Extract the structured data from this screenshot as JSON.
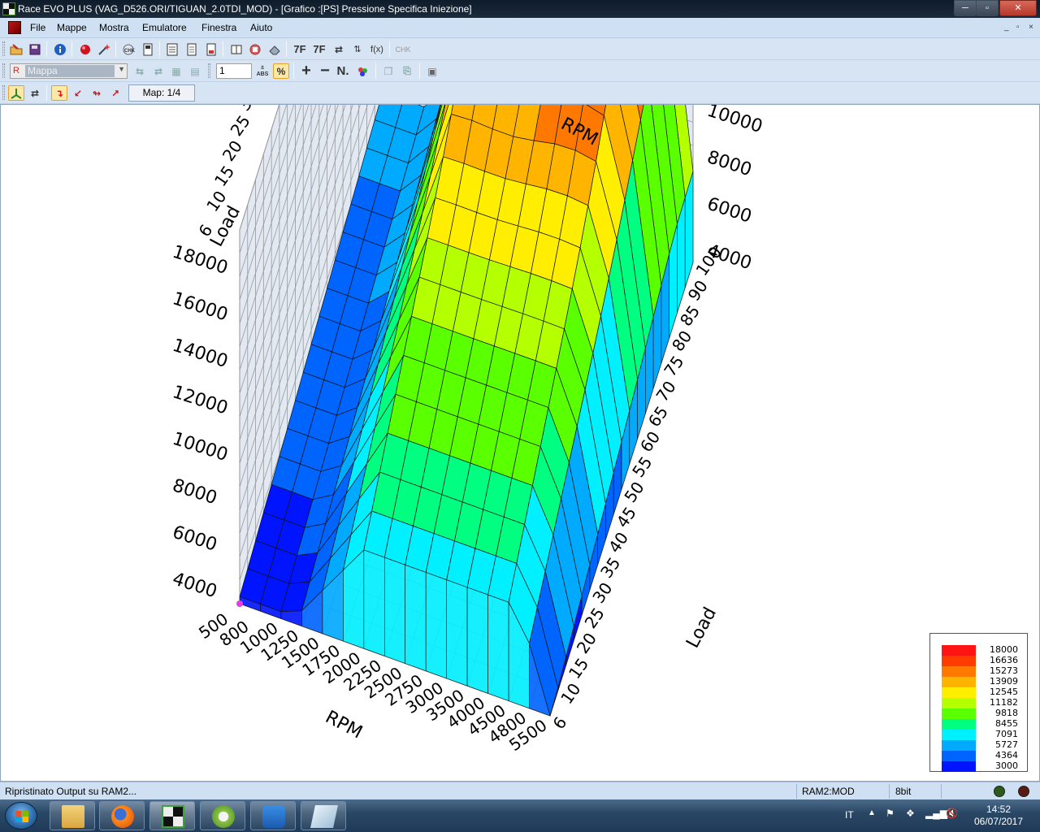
{
  "window": {
    "title": "Race EVO PLUS (VAG_D526.ORI/TIGUAN_2.0TDI_MOD) - [Grafico :[PS] Pressione Specifica Iniezione]",
    "minimize_glyph": "─",
    "maximize_glyph": "▫",
    "close_glyph": "✕"
  },
  "menu": {
    "items": [
      "File",
      "Mappe",
      "Mostra",
      "Emulatore",
      "Finestra",
      "Aiuto"
    ],
    "mdi_min": "_",
    "mdi_restore": "▫",
    "mdi_close": "×"
  },
  "toolbar1": {
    "icons": [
      "open-icon",
      "save-icon",
      "info-icon",
      "record-icon",
      "magic-icon",
      "checksum-icon",
      "page-icon",
      "calc-icon",
      "doc-icon",
      "pdf-icon",
      "book-icon",
      "reload-icon",
      "eraser-icon"
    ],
    "text_buttons": {
      "hex7f": "7F",
      "and7f": "7F",
      "swap": "⇄",
      "fx": "f(x)",
      "chk": "CHK"
    }
  },
  "toolbar2": {
    "combo_prefix": "R",
    "combo_value": "Mappa",
    "number_value": "1",
    "abs_label": "ABS",
    "plus": "+",
    "minus": "−",
    "n_label": "N."
  },
  "toolbar3": {
    "map_label": "Map: 1/4"
  },
  "graph": {
    "rpm_label": "RPM",
    "load_label": "Load",
    "rpm_ticks": [
      "500",
      "800",
      "1000",
      "1250",
      "1500",
      "1750",
      "2000",
      "2250",
      "2500",
      "2750",
      "3000",
      "3500",
      "4000",
      "4500",
      "4800",
      "5500"
    ],
    "pressure_ticks": [
      "4000",
      "6000",
      "8000",
      "10000",
      "12000",
      "14000",
      "16000",
      "18000"
    ],
    "load_ticks": [
      "6",
      "10",
      "15",
      "20",
      "25",
      "30",
      "35",
      "40",
      "45",
      "50",
      "55",
      "60",
      "65",
      "70",
      "75",
      "80",
      "85",
      "90",
      "100"
    ]
  },
  "legend": {
    "entries": [
      {
        "value": "18000",
        "color": "#ff1414"
      },
      {
        "value": "16636",
        "color": "#ff3c00"
      },
      {
        "value": "15273",
        "color": "#ff7800"
      },
      {
        "value": "13909",
        "color": "#ffb400"
      },
      {
        "value": "12545",
        "color": "#ffee00"
      },
      {
        "value": "11182",
        "color": "#b4ff00"
      },
      {
        "value": "9818",
        "color": "#5aff00"
      },
      {
        "value": "8455",
        "color": "#00ff80"
      },
      {
        "value": "7091",
        "color": "#00f0ff"
      },
      {
        "value": "5727",
        "color": "#00aaff"
      },
      {
        "value": "4364",
        "color": "#0064ff"
      },
      {
        "value": "3000",
        "color": "#0014ff"
      }
    ]
  },
  "status": {
    "message": "Ripristinato Output su RAM2...",
    "ram": "RAM2:MOD",
    "bits": "8bit"
  },
  "taskbar": {
    "apps": [
      "explorer-icon",
      "firefox-icon",
      "race-evo-icon",
      "chiptuning-icon",
      "teamviewer-icon",
      "notepad-icon"
    ],
    "lang": "IT",
    "time": "14:52",
    "date": "06/07/2017"
  }
}
